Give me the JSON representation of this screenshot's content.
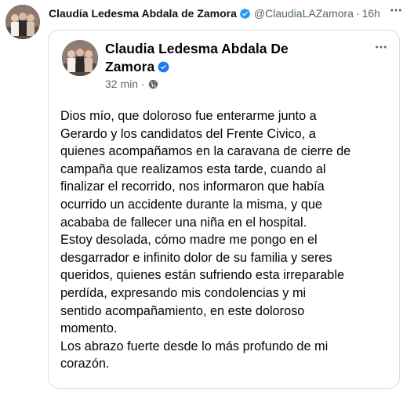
{
  "tweet": {
    "author_name": "Claudia Ledesma Abdala de Zamora",
    "handle": "@ClaudiaLAZamora",
    "separator": "·",
    "time": "16h",
    "more_icon": "more-horizontal-icon"
  },
  "facebook_post": {
    "author_name_line1": "Claudia Ledesma Abdala De",
    "author_name_line2": "Zamora",
    "time": "32 min",
    "separator": "·",
    "privacy_icon": "globe-icon",
    "more_icon": "more-horizontal-icon",
    "body_lines": [
      "Dios mío, que doloroso fue enterarme junto a",
      "Gerardo y los candidatos del Frente Civico,  a",
      "quienes acompañamos en la caravana de cierre de",
      "campaña que realizamos esta tarde, cuando al",
      "finalizar el recorrido, nos informaron que había",
      "ocurrido un accidente durante la misma, y que",
      "acababa  de fallecer una niña en el hospital.",
      "Estoy desolada, cómo  madre me pongo en el",
      "desgarrador e infinito dolor de su familia y seres",
      "queridos, quienes  están sufriendo esta irreparable",
      "perdída, expresando  mis condolencias y mi",
      "sentido acompañamiento, en este doloroso",
      "momento.",
      "Los abrazo fuerte desde lo más profundo de mi",
      "corazón."
    ]
  },
  "colors": {
    "verified_blue": "#1d9bf0",
    "muted_text": "#536471",
    "card_border": "#dadde1"
  }
}
